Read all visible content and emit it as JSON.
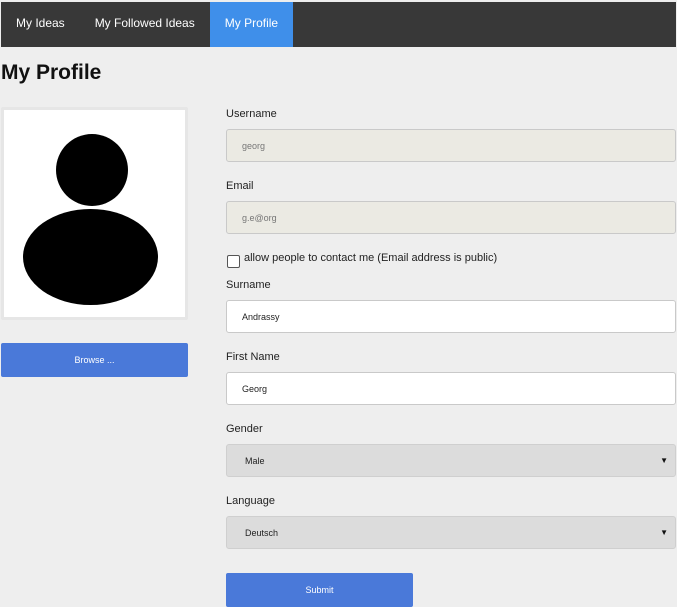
{
  "nav": {
    "items": [
      {
        "label": "My Ideas",
        "active": false
      },
      {
        "label": "My Followed Ideas",
        "active": false
      },
      {
        "label": "My Profile",
        "active": true
      }
    ]
  },
  "page": {
    "title": "My Profile"
  },
  "avatar": {
    "icon": "person-silhouette-icon",
    "browse_label": "Browse ..."
  },
  "form": {
    "username": {
      "label": "Username",
      "value": "georg"
    },
    "email": {
      "label": "Email",
      "value": "g.e@org"
    },
    "contact": {
      "label": "allow people to contact me (Email address is public)",
      "checked": false
    },
    "surname": {
      "label": "Surname",
      "value": "Andrassy"
    },
    "first_name": {
      "label": "First Name",
      "value": "Georg"
    },
    "gender": {
      "label": "Gender",
      "value": "Male"
    },
    "language": {
      "label": "Language",
      "value": "Deutsch"
    },
    "submit_label": "Submit"
  },
  "colors": {
    "nav_bg": "#383838",
    "nav_active": "#3f8fea",
    "button": "#4a79d9",
    "page_bg": "#eeeeee"
  }
}
